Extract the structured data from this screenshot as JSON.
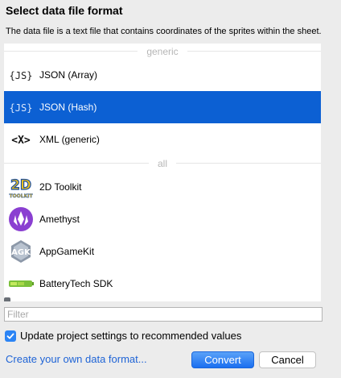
{
  "dialog": {
    "title": "Select data file format",
    "description": "The data file is a text file that contains coordinates of the sprites within the sheet."
  },
  "list": {
    "sections": [
      {
        "header": "generic",
        "items": [
          {
            "label": "JSON (Array)",
            "icon": "json-array-icon",
            "selected": false
          },
          {
            "label": "JSON (Hash)",
            "icon": "json-hash-icon",
            "selected": true
          },
          {
            "label": "XML (generic)",
            "icon": "xml-icon",
            "selected": false
          }
        ]
      },
      {
        "header": "all",
        "items": [
          {
            "label": "2D Toolkit",
            "icon": "2d-toolkit-icon",
            "selected": false
          },
          {
            "label": "Amethyst",
            "icon": "amethyst-icon",
            "selected": false
          },
          {
            "label": "AppGameKit",
            "icon": "appgamekit-icon",
            "selected": false
          },
          {
            "label": "BatteryTech SDK",
            "icon": "batterytech-icon",
            "selected": false
          }
        ]
      }
    ]
  },
  "icons": {
    "json_glyph": "{JS}",
    "xml_glyph": "<X>",
    "toolkit_top": "2D",
    "toolkit_bottom": "TOOLKIT",
    "agk_glyph": "AGK"
  },
  "filter": {
    "placeholder": "Filter",
    "value": ""
  },
  "options": {
    "update_settings_label": "Update project settings to recommended values",
    "update_settings_checked": true
  },
  "footer": {
    "create_link": "Create your own data format...",
    "convert_label": "Convert",
    "cancel_label": "Cancel"
  },
  "colors": {
    "selection": "#0c60d3",
    "link": "#1f64d6",
    "checkbox": "#2b84f5",
    "amethyst": "#8a3fd1",
    "toolkit_yellow": "#f2c21b"
  }
}
